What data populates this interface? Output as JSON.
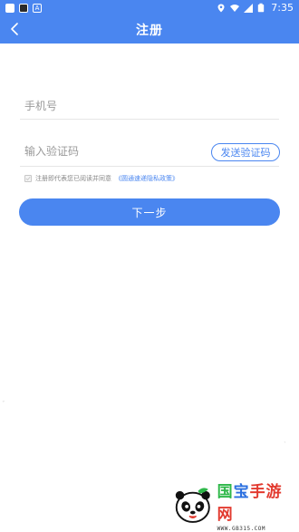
{
  "status_bar": {
    "time": "7:35",
    "left_icons": [
      "notification-icon",
      "photo-icon",
      "a-icon"
    ],
    "right_icons": [
      "location-icon",
      "wifi-icon",
      "signal-icon",
      "battery-icon"
    ]
  },
  "header": {
    "title": "注册",
    "back_icon": "chevron-left-icon"
  },
  "form": {
    "phone_placeholder": "手机号",
    "phone_value": "",
    "code_placeholder": "输入验证码",
    "code_value": "",
    "send_code_label": "发送验证码"
  },
  "agreement": {
    "checked": false,
    "text": "注册即代表您已阅读并同意",
    "link": "《圆通速递隐私政策》"
  },
  "next_button": "下一步",
  "watermark": {
    "title_parts": [
      "国",
      "宝",
      "手游网"
    ],
    "url": "WWW.GB315.COM"
  },
  "colors": {
    "primary": "#4a86f0",
    "wm_green": "#2fb84a",
    "wm_blue": "#2a6fe0",
    "wm_red": "#e23a2f"
  }
}
